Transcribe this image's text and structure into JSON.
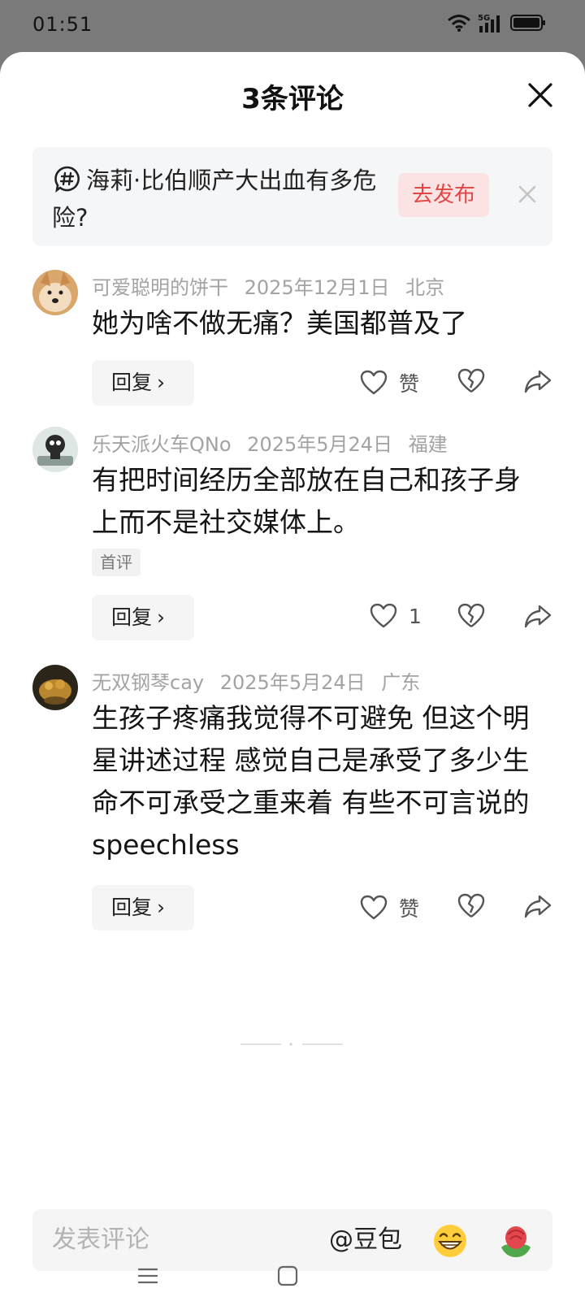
{
  "status_bar": {
    "time": "01:51",
    "network": "5G"
  },
  "sheet": {
    "title": "3条评论"
  },
  "topic": {
    "text": "海莉·比伯顺产大出血有多危险?",
    "publish_label": "去发布"
  },
  "comments": [
    {
      "username": "可爱聪明的饼干",
      "date": "2025年12月1日",
      "location": "北京",
      "text": "她为啥不做无痛？美国都普及了",
      "reply_label": "回复",
      "like_label": "赞"
    },
    {
      "username": "乐天派火车QNo",
      "date": "2025年5月24日",
      "location": "福建",
      "text": "有把时间经历全部放在自己和孩子身上而不是社交媒体上。",
      "badge": "首评",
      "reply_label": "回复",
      "like_label": "1"
    },
    {
      "username": "无双钢琴cay",
      "date": "2025年5月24日",
      "location": "广东",
      "text": "生孩子疼痛我觉得不可避免 但这个明星讲述过程 感觉自己是承受了多少生命不可承受之重来着 有些不可言说的speechless",
      "reply_label": "回复",
      "like_label": "赞"
    }
  ],
  "input": {
    "placeholder": "发表评论",
    "mention": "@豆包"
  }
}
